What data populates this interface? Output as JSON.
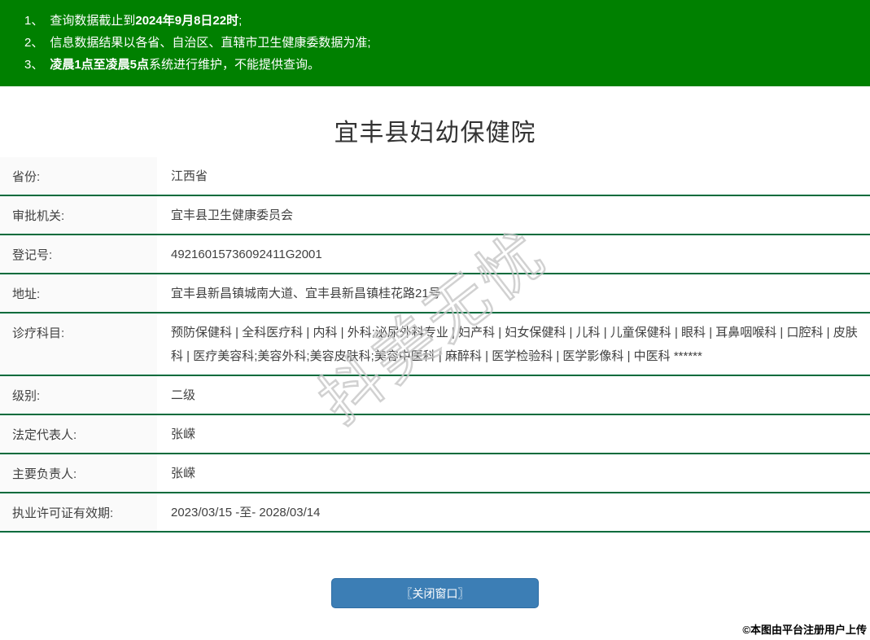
{
  "colors": {
    "banner_bg": "#008000",
    "divider_green": "#006b3c",
    "label_bg": "#fafafa",
    "button_blue": "#3c7eb5",
    "watermark_gray": "#c6c6c6"
  },
  "notices": {
    "items": [
      {
        "num": "1、",
        "pre": "查询数据截止到",
        "bold": "2024年9月8日22时",
        "post": ";"
      },
      {
        "num": "2、",
        "pre": "信息数据结果以各省、自治区、直辖市卫生健康委数据为准;",
        "bold": "",
        "post": ""
      },
      {
        "num": "3、",
        "pre": "",
        "bold": "凌晨1点至凌晨5点",
        "post": "系统进行维护，不能提供查询。"
      }
    ]
  },
  "header": {
    "title": "宜丰县妇幼保健院"
  },
  "table": {
    "rows": [
      {
        "label": "省份:",
        "value": "江西省",
        "multiline": false
      },
      {
        "label": "审批机关:",
        "value": "宜丰县卫生健康委员会",
        "multiline": false
      },
      {
        "label": "登记号:",
        "value": "49216015736092411G2001",
        "multiline": false
      },
      {
        "label": "地址:",
        "value": "宜丰县新昌镇城南大道、宜丰县新昌镇桂花路21号",
        "multiline": false
      },
      {
        "label": "诊疗科目:",
        "value": "预防保健科 | 全科医疗科 | 内科 | 外科;泌尿外科专业 | 妇产科 | 妇女保健科 | 儿科 | 儿童保健科 | 眼科 | 耳鼻咽喉科 | 口腔科 | 皮肤科 | 医疗美容科;美容外科;美容皮肤科;美容中医科 | 麻醉科 | 医学检验科 | 医学影像科 | 中医科 ******",
        "multiline": true
      },
      {
        "label": "级别:",
        "value": "二级",
        "multiline": false
      },
      {
        "label": "法定代表人:",
        "value": "张嵘",
        "multiline": false
      },
      {
        "label": "主要负责人:",
        "value": "张嵘",
        "multiline": false
      },
      {
        "label": "执业许可证有效期:",
        "value": "2023/03/15 -至- 2028/03/14",
        "multiline": false
      }
    ]
  },
  "footer": {
    "close_button_label": "〖关闭窗口〗",
    "copyright": "©本图由平台注册用户上传"
  },
  "watermark": {
    "text": "抖美无忧"
  }
}
